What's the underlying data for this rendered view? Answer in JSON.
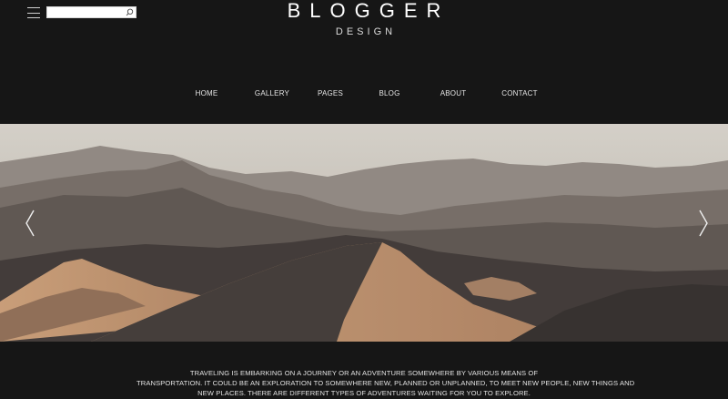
{
  "header": {
    "menu_icon": "hamburger-menu-icon",
    "search": {
      "value": "",
      "placeholder": "",
      "icon": "search-icon"
    },
    "logo": {
      "title": "BLOGGER",
      "subtitle": "DESIGN"
    }
  },
  "nav": {
    "items": [
      {
        "label": "HOME"
      },
      {
        "label": "GALLERY"
      },
      {
        "label": "PAGES"
      },
      {
        "label": "BLOG"
      },
      {
        "label": "ABOUT"
      },
      {
        "label": "CONTACT"
      }
    ]
  },
  "hero": {
    "prev_icon": "chevron-left-icon",
    "next_icon": "chevron-right-icon"
  },
  "intro": {
    "lines": [
      "TRAVELING IS EMBARKING ON A JOURNEY OR AN ADVENTURE SOMEWHERE BY VARIOUS MEANS OF",
      "TRANSPORTATION. IT COULD BE AN EXPLORATION TO SOMEWHERE NEW, PLANNED OR UNPLANNED, TO MEET NEW PEOPLE, NEW THINGS AND",
      "NEW PLACES. THERE ARE DIFFERENT TYPES OF ADVENTURES WAITING FOR YOU TO EXPLORE."
    ]
  },
  "colors": {
    "background": "#161616",
    "text": "#e9e9e9",
    "sand": "#b98a66"
  }
}
